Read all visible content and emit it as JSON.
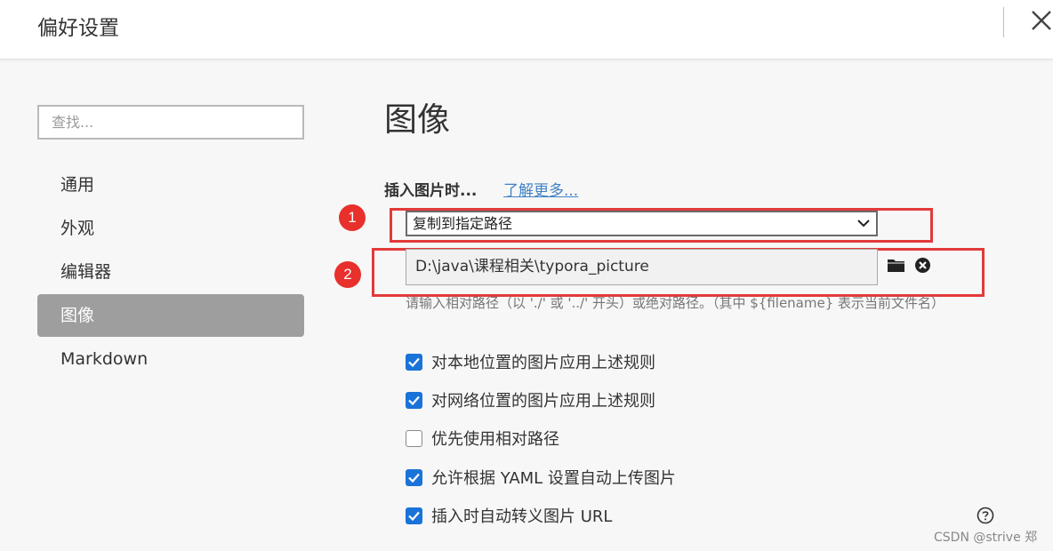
{
  "window": {
    "title": "偏好设置"
  },
  "sidebar": {
    "search_placeholder": "查找...",
    "items": [
      {
        "label": "通用",
        "active": false
      },
      {
        "label": "外观",
        "active": false
      },
      {
        "label": "编辑器",
        "active": false
      },
      {
        "label": "图像",
        "active": true
      },
      {
        "label": "Markdown",
        "active": false
      }
    ]
  },
  "main": {
    "title": "图像",
    "insert_label": "插入图片时...",
    "learn_more": "了解更多...",
    "insert_action": "复制到指定路径",
    "path_value": "D:\\java\\课程相关\\typora_picture",
    "hint": "请输入相对路径（以 './' 或 '../' 开头）或绝对路径。（其中 ${filename} 表示当前文件名）",
    "checkboxes": [
      {
        "label": "对本地位置的图片应用上述规则",
        "checked": true
      },
      {
        "label": "对网络位置的图片应用上述规则",
        "checked": true
      },
      {
        "label": "优先使用相对路径",
        "checked": false
      },
      {
        "label": "允许根据 YAML 设置自动上传图片",
        "checked": true
      },
      {
        "label": "插入时自动转义图片 URL",
        "checked": true
      }
    ]
  },
  "annotations": {
    "marker1": "1",
    "marker2": "2"
  },
  "watermark": "CSDN @strive 郑",
  "icons": {
    "close": "close-icon",
    "folder": "folder-icon",
    "clear": "clear-circle-icon",
    "help": "help-icon",
    "chevron": "chevron-down-icon"
  },
  "colors": {
    "accent": "#1a73d9",
    "active_nav": "#9e9e9e",
    "annotation_red": "#e23a3a",
    "link": "#4183c4"
  }
}
